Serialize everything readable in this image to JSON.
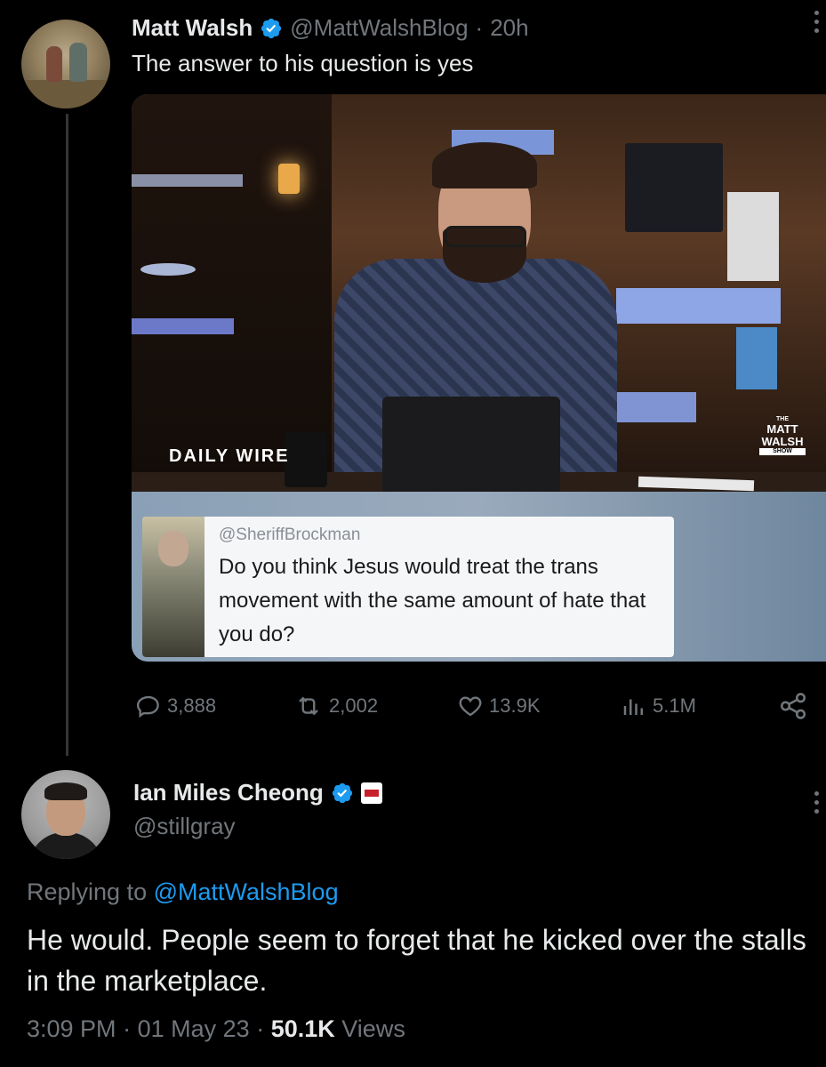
{
  "tweet1": {
    "author_name": "Matt Walsh",
    "handle": "@MattWalshBlog",
    "separator": "·",
    "time": "20h",
    "text": "The answer to his question is yes",
    "media": {
      "brand_left": "DAILY WIRE",
      "brand_right_lines": [
        "THE",
        "MATT",
        "WALSH",
        "SHOW"
      ],
      "quote_handle": "@SheriffBrockman",
      "quote_text": "Do you think Jesus would treat the trans movement with the same amount of hate that you do?"
    },
    "stats": {
      "replies": "3,888",
      "reposts": "2,002",
      "likes": "13.9K",
      "views": "5.1M"
    }
  },
  "tweet2": {
    "author_name": "Ian Miles Cheong",
    "handle": "@stillgray",
    "replying_prefix": "Replying to",
    "replying_handle": "@MattWalshBlog",
    "text": "He would. People seem to forget that he kicked over the stalls in the marketplace.",
    "time": "3:09 PM",
    "date": "01 May 23",
    "separator": "·",
    "views_count": "50.1K",
    "views_label": "Views"
  },
  "colors": {
    "background": "#000000",
    "primary_text": "#e7e9ea",
    "secondary_text": "#71767b",
    "link": "#1d9bf0",
    "verified": "#1d9bf0"
  },
  "icons": [
    "verified-badge-icon",
    "more-icon",
    "reply-icon",
    "repost-icon",
    "like-icon",
    "views-icon",
    "share-icon",
    "news-affiliate-badge-icon"
  ]
}
